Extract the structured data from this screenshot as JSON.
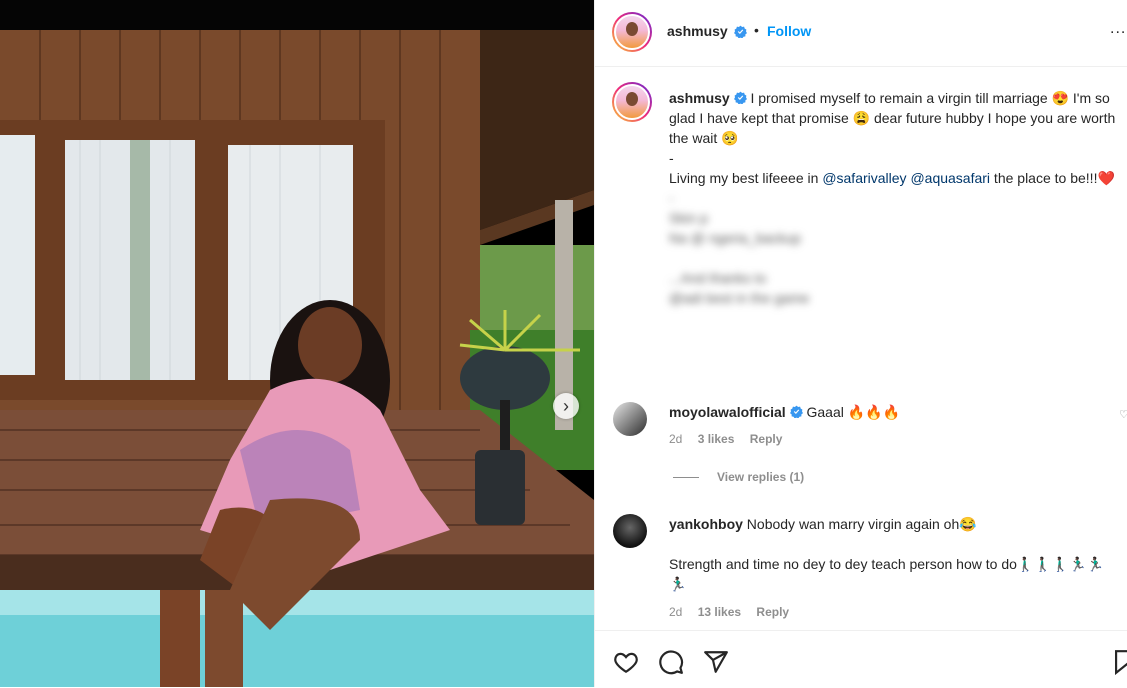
{
  "post": {
    "username": "ashmusy",
    "header_separator": "•",
    "follow_label": "Follow",
    "more_label": "..."
  },
  "caption": {
    "username": "ashmusy",
    "line1": "I promised myself to remain a virgin till marriage 😍 I'm so glad I have kept that promise 😩 dear future hubby I hope you are worth the wait 🥺",
    "dash1": "-",
    "line2_prefix": "Living my best lifeeee in ",
    "mention1": "@safarivalley",
    "mention2": "@aquasafari",
    "line2_suffix": " the place to be!!!❤️",
    "dash2": "-",
    "blurred1": "Skin p",
    "blurred2": "Na @ ngeria_backup",
    "blurred3": "",
    "blurred4": "...And thanks to",
    "blurred5": "@adi best in the game"
  },
  "comments": [
    {
      "username": "moyolawalofficial",
      "text": "Gaaal 🔥🔥🔥",
      "time": "2d",
      "likes": "3 likes",
      "reply": "Reply",
      "view_replies": "View replies (1)"
    },
    {
      "username": "yankohboy",
      "text": "Nobody wan marry virgin again oh😂",
      "text2": "Strength and time no dey to dey teach person how to do🚶🏿‍♂️🚶🏿‍♂️🚶🏿‍♂️🏃🏿‍♂️🏃🏿‍♂️🏃🏿‍♂️",
      "time": "2d",
      "likes": "13 likes",
      "reply": "Reply"
    }
  ],
  "photo": {
    "next_glyph": "›"
  },
  "colors": {
    "accent": "#0095f6",
    "verified": "#3897f0",
    "mention": "#00376b",
    "meta": "#8e8e8e"
  },
  "icons": [
    "heart-icon",
    "comment-icon",
    "share-icon",
    "bookmark-icon",
    "verified-badge-icon",
    "chevron-right-icon",
    "more-icon"
  ]
}
